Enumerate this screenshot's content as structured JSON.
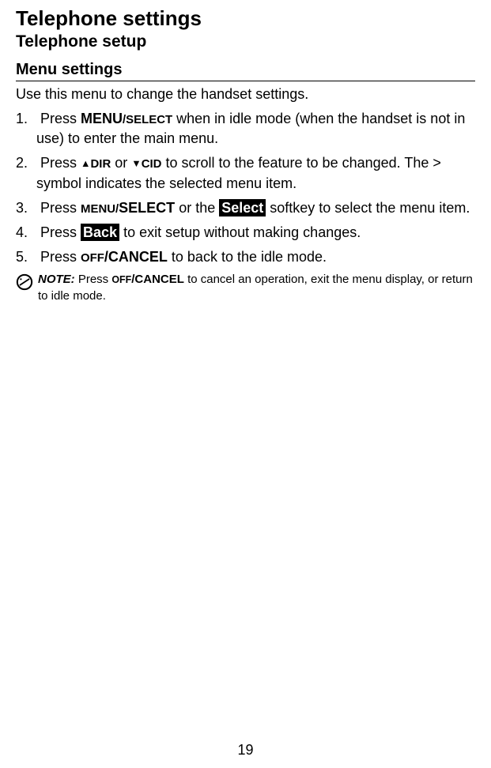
{
  "title": "Telephone settings",
  "subtitle": "Telephone setup",
  "section_heading": "Menu settings",
  "intro": "Use this menu to change the handset settings.",
  "steps": {
    "s1": {
      "prefix": "Press ",
      "key_bold": "MENU",
      "key_small": "/SELECT",
      "suffix": " when in idle mode (when the handset is not in use) to enter the main menu."
    },
    "s2": {
      "prefix": "Press ",
      "dir_tri": "▲",
      "dir_label": "DIR",
      "or": " or ",
      "cid_tri": "▼",
      "cid_label": "CID",
      "mid": " to scroll to the feature to be changed. The > symbol indicates the selected menu item."
    },
    "s3": {
      "prefix": "Press ",
      "key_small": "MENU/",
      "key_bold": "SELECT",
      "or_the": " or the ",
      "softkey": "Select",
      "suffix": " softkey to select the menu item."
    },
    "s4": {
      "prefix": "Press ",
      "softkey": "Back",
      "suffix": " to exit setup without making changes."
    },
    "s5": {
      "prefix": "Press ",
      "key_small": "OFF",
      "key_bold": "/CANCEL",
      "suffix": " to back to the idle mode."
    }
  },
  "note": {
    "label": "NOTE:",
    "before": " Press ",
    "key_small": "OFF",
    "key_bold": "/CANCEL",
    "after": " to cancel an operation, exit the menu display, or return to idle mode."
  },
  "page_number": "19"
}
